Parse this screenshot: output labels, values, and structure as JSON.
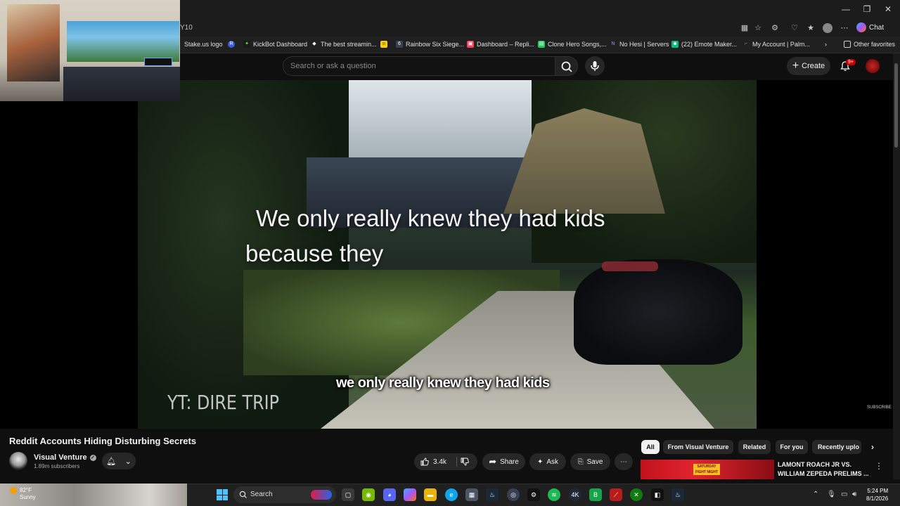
{
  "browser": {
    "url_fragment": "Y10",
    "chat_label": "Chat",
    "window_controls": [
      "—",
      "❐",
      "✕"
    ]
  },
  "bookmarks": [
    {
      "label": "Stake.us logo",
      "color": "#1f2937"
    },
    {
      "label": "R",
      "color": "#3b5bdb"
    },
    {
      "label": "KickBot Dashboard",
      "color": "#53fc18"
    },
    {
      "label": "The best streamin...",
      "color": "#ffffff"
    },
    {
      "label": "",
      "color": "#facc15"
    },
    {
      "label": "Rainbow Six Siege...",
      "color": "#374151"
    },
    {
      "label": "Dashboard – Repli...",
      "color": "#f43f5e"
    },
    {
      "label": "Clone Hero Songs,...",
      "color": "#22c55e"
    },
    {
      "label": "No Hesi | Servers",
      "color": "#7c3aed"
    },
    {
      "label": "(22) Emote Maker...",
      "color": "#10b981"
    },
    {
      "label": "My Account | Palm...",
      "color": "#6b7280"
    },
    {
      "label": "Other favorites",
      "color": "#e5e7eb"
    }
  ],
  "youtube": {
    "search_placeholder": "Search or ask a question",
    "create_label": "Create",
    "notifications_badge": "9+"
  },
  "video": {
    "overlay_line1": "We only really knew they had kids",
    "overlay_line2": "because they",
    "caption": "we only really knew they had kids",
    "watermark": "YT: DIRE TRIP",
    "subscribe_watermark": "SUBSCRIBE"
  },
  "video_info": {
    "title": "Reddit Accounts Hiding Disturbing Secrets",
    "channel": "Visual Venture",
    "subscribers": "1.89m subscribers",
    "likes": "3.4k",
    "share_label": "Share",
    "ask_label": "Ask",
    "save_label": "Save"
  },
  "chips": [
    "All",
    "From Visual Venture",
    "Related",
    "For you",
    "Recently uplo"
  ],
  "recommendation": {
    "title": "LAMONT ROACH JR VS. WILLIAM ZEPEDA PRELIMS ...",
    "thumb_text": "SATURDAY FIGHT NIGHT"
  },
  "taskbar": {
    "temperature": "82°F",
    "condition": "Sunny",
    "search_label": "Search",
    "time": "5:24 PM",
    "date": "8/1/2026"
  }
}
